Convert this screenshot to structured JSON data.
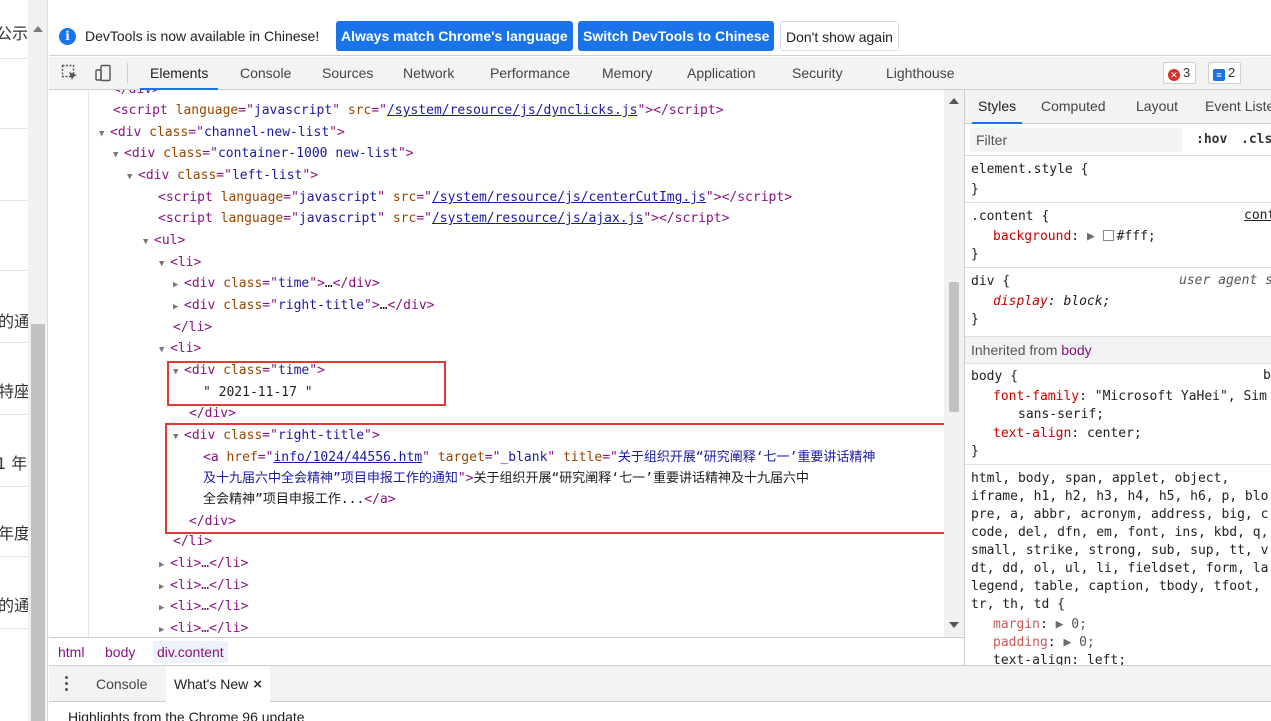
{
  "page": {
    "fragments": [
      "公示",
      "的通",
      "特座",
      "1 年",
      "年度",
      "的通"
    ]
  },
  "infobar": {
    "message": "DevTools is now available in Chinese!",
    "btn_match": "Always match Chrome's language",
    "btn_switch": "Switch DevTools to Chinese",
    "btn_dismiss": "Don't show again",
    "icon": "info-icon"
  },
  "toolbar": {
    "tabs": [
      "Elements",
      "Console",
      "Sources",
      "Network",
      "Performance",
      "Memory",
      "Application",
      "Security",
      "Lighthouse"
    ],
    "active_tab": "Elements",
    "errors_count": "3",
    "messages_count": "2",
    "icons": [
      "inspect-icon",
      "device-toolbar-icon",
      "error-icon",
      "message-icon"
    ]
  },
  "dom": {
    "div_close": "</div>",
    "li_close": "</li>",
    "li_open": "<li>",
    "ul_open": "<ul>",
    "script1_src": "/system/resource/js/dynclicks.js",
    "channel_class": "channel-new-list",
    "container_class": "container-1000 new-list",
    "leftlist_class": "left-list",
    "script2_src": "/system/resource/js/centerCutImg.js",
    "script3_src": "/system/resource/js/ajax.js",
    "time_class": "time",
    "right_title_class": "right-title",
    "date_text": "\" 2021-11-17 \"",
    "href": "info/1024/44556.htm",
    "target": "_blank",
    "title_attr_1": "关于组织开展“研究阐释‘七一’重要讲话精神",
    "title_attr_2": "及十九届六中全会精神”项目申报工作的通知",
    "link_text_1": "关于组织开展“研究阐释‘七一’重要讲话精神及十九届六中",
    "link_text_2": "全会精神”项目申报工作...",
    "collapsed_li": "<li>…</li>"
  },
  "breadcrumbs": [
    "html",
    "body",
    "div.content"
  ],
  "styles": {
    "tabs": [
      "Styles",
      "Computed",
      "Layout",
      "Event Liste"
    ],
    "active_tab": "Styles",
    "filter_placeholder": "Filter",
    "hov": ":hov",
    "cls": ".cls",
    "element_style": "element.style {",
    "close_brace": "}",
    "content_selector": ".content {",
    "content_source": "cont",
    "background_prop": "background",
    "background_val": "#fff;",
    "div_selector": "div {",
    "div_source": "user agent s",
    "display_prop": "display",
    "display_val": "block;",
    "inherited_label": "Inherited from",
    "inherited_from": "body",
    "body_selector": "body {",
    "body_source": "b",
    "font_family_prop": "font-family",
    "font_family_val": "\"Microsoft YaHei\", Sim",
    "font_family_cont": "sans-serif;",
    "text_align_prop": "text-align",
    "text_align_val": "center;",
    "reset_selectors": [
      "html, body, span, applet, object,",
      "iframe, h1, h2, h3, h4, h5, h6, p, blo",
      "pre, a, abbr, acronym, address, big, c",
      "code, del, dfn, em, font, ins, kbd, q,",
      "small, strike, strong, sub, sup, tt, v",
      "dt, dd, ol, ul, li, fieldset, form, la",
      "legend, table, caption, tbody, tfoot,",
      "tr, th, td {"
    ],
    "margin_prop": "margin",
    "margin_val": "0;",
    "padding_prop": "padding",
    "padding_val": "0;",
    "text_align_left": "left;"
  },
  "drawer": {
    "tabs": [
      "Console",
      "What's New"
    ],
    "active_tab": "What's New",
    "highlight": "Highlights from the Chrome 96 update"
  },
  "colors": {
    "accent": "#1a73e8",
    "highlight_border": "#e53935",
    "tag": "#881280",
    "attr_name": "#994500",
    "attr_value": "#1a1aa6"
  }
}
